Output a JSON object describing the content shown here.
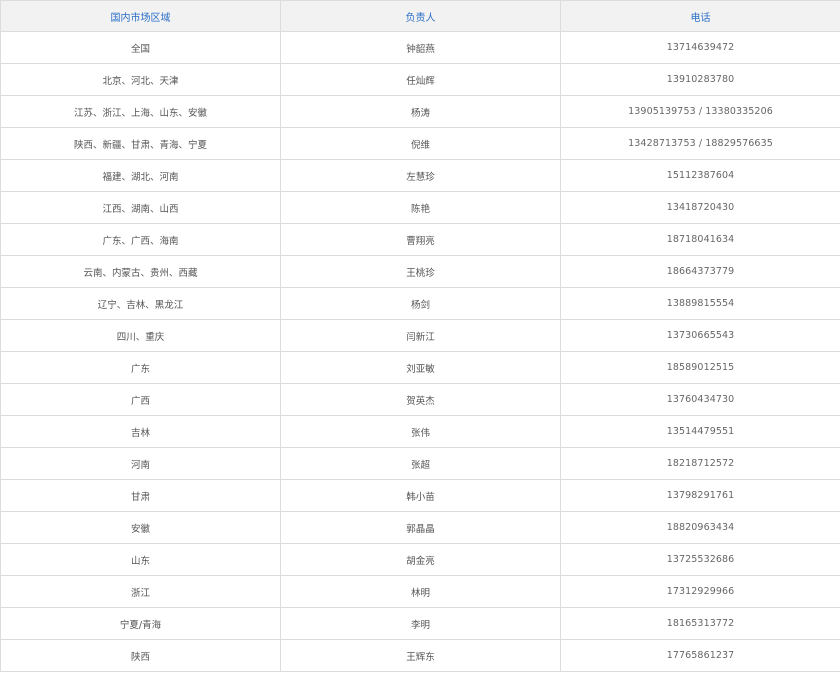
{
  "table": {
    "headers": [
      "国内市场区域",
      "负责人",
      "电话"
    ],
    "rows": [
      {
        "region": "全国",
        "person": "钟韶燕",
        "phone": "13714639472"
      },
      {
        "region": "北京、河北、天津",
        "person": "任灿辉",
        "phone": "13910283780"
      },
      {
        "region": "江苏、浙江、上海、山东、安徽",
        "person": "杨涛",
        "phone": "13905139753 / 13380335206"
      },
      {
        "region": "陕西、新疆、甘肃、青海、宁夏",
        "person": "倪维",
        "phone": "13428713753 / 18829576635"
      },
      {
        "region": "福建、湖北、河南",
        "person": "左慧珍",
        "phone": "15112387604"
      },
      {
        "region": "江西、湖南、山西",
        "person": "陈艳",
        "phone": "13418720430"
      },
      {
        "region": "广东、广西、海南",
        "person": "曹翔亮",
        "phone": "18718041634"
      },
      {
        "region": "云南、内蒙古、贵州、西藏",
        "person": "王桃珍",
        "phone": "18664373779"
      },
      {
        "region": "辽宁、吉林、黑龙江",
        "person": "杨剑",
        "phone": "13889815554"
      },
      {
        "region": "四川、重庆",
        "person": "闫新江",
        "phone": "13730665543"
      },
      {
        "region": "广东",
        "person": "刘亚敏",
        "phone": "18589012515"
      },
      {
        "region": "广西",
        "person": "贺英杰",
        "phone": "13760434730"
      },
      {
        "region": "吉林",
        "person": "张伟",
        "phone": "13514479551"
      },
      {
        "region": "河南",
        "person": "张超",
        "phone": "18218712572"
      },
      {
        "region": "甘肃",
        "person": "韩小苗",
        "phone": "13798291761"
      },
      {
        "region": "安徽",
        "person": "郭晶晶",
        "phone": "18820963434"
      },
      {
        "region": "山东",
        "person": "胡金亮",
        "phone": "13725532686"
      },
      {
        "region": "浙江",
        "person": "林明",
        "phone": "17312929966"
      },
      {
        "region": "宁夏/青海",
        "person": "李明",
        "phone": "18165313772"
      },
      {
        "region": "陕西",
        "person": "王辉东",
        "phone": "17765861237"
      }
    ]
  }
}
